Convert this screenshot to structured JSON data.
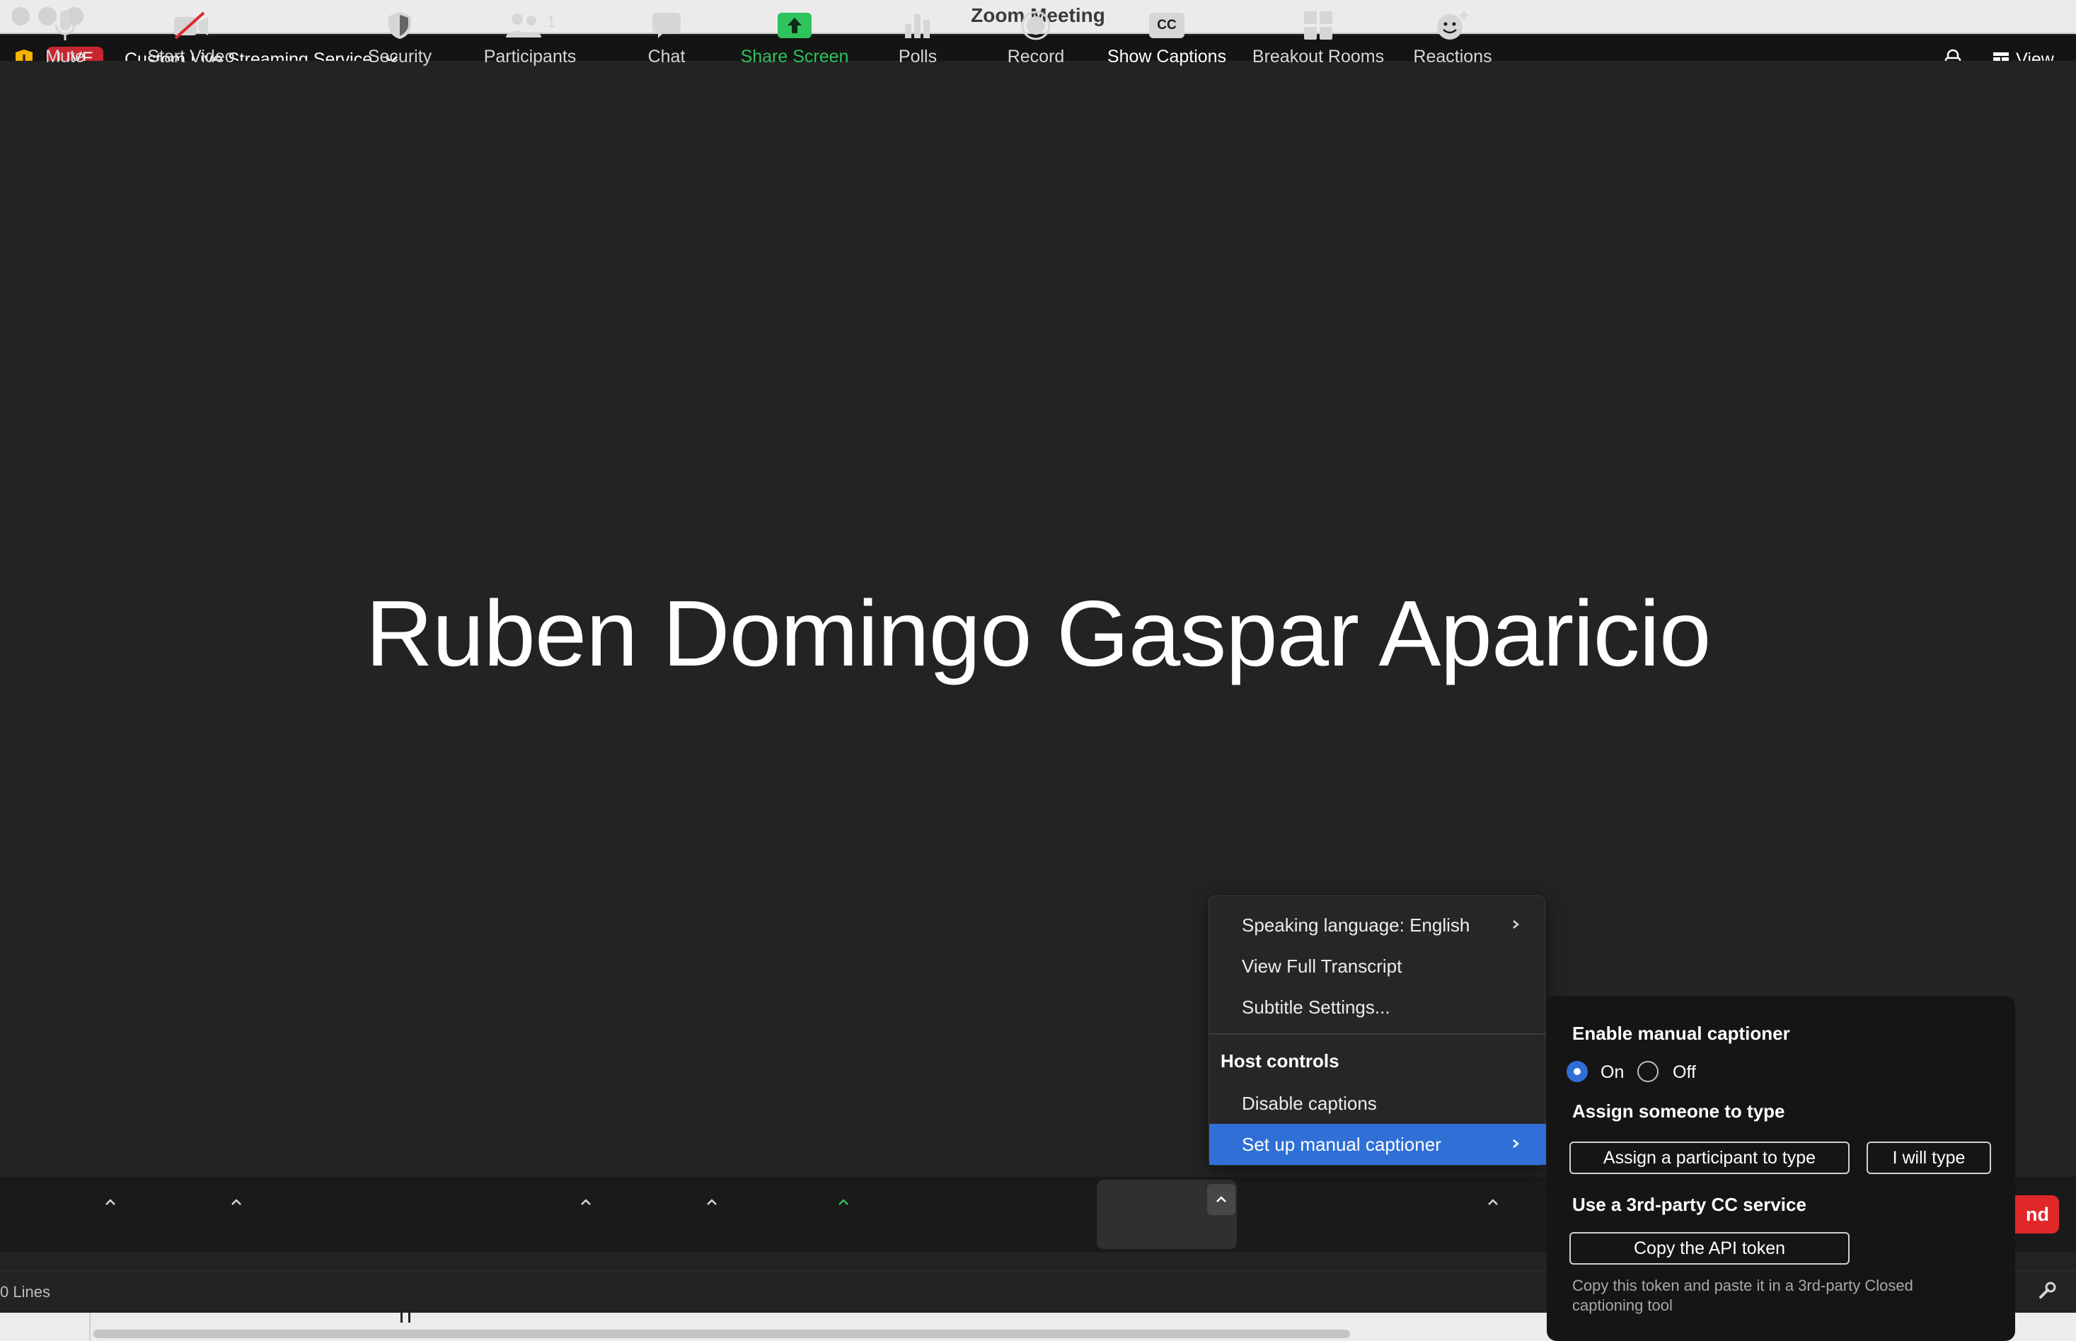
{
  "window": {
    "title": "Zoom Meeting"
  },
  "top_bar": {
    "live_badge": "LIVE",
    "stream_service": "Custom Live Streaming Service",
    "view_label": "View"
  },
  "stage": {
    "speaker_name": "Ruben Domingo Gaspar Aparicio"
  },
  "toolbar": {
    "mute": "Mute",
    "start_video": "Start Video",
    "security": "Security",
    "participants": "Participants",
    "participants_count": "1",
    "chat": "Chat",
    "share_screen": "Share Screen",
    "polls": "Polls",
    "record": "Record",
    "show_captions": "Show Captions",
    "cc_glyph": "CC",
    "breakout_rooms": "Breakout Rooms",
    "reactions": "Reactions",
    "end_partial": "nd",
    "share_color": "#2fc35b",
    "end_color": "#e02828"
  },
  "captions_menu": {
    "items": [
      {
        "label": "Speaking language: English",
        "has_submenu": true
      },
      {
        "label": "View Full Transcript",
        "has_submenu": false
      },
      {
        "label": "Subtitle Settings...",
        "has_submenu": false
      }
    ],
    "host_header": "Host controls",
    "host_items": [
      {
        "label": "Disable captions",
        "has_submenu": false
      },
      {
        "label": "Set up manual captioner",
        "has_submenu": true,
        "selected": true
      }
    ],
    "selected_color": "#2f6fd6"
  },
  "captioner_panel": {
    "enable_heading": "Enable manual captioner",
    "on_label": "On",
    "off_label": "Off",
    "selected_option": "On",
    "assign_heading": "Assign someone to type",
    "assign_button": "Assign a participant to type",
    "self_button": "I will type",
    "third_party_heading": "Use a 3rd-party CC service",
    "copy_button": "Copy the API token",
    "hint": "Copy this token and paste it in a 3rd-party Closed captioning tool"
  },
  "status_bar": {
    "lines_label": "0 Lines"
  }
}
